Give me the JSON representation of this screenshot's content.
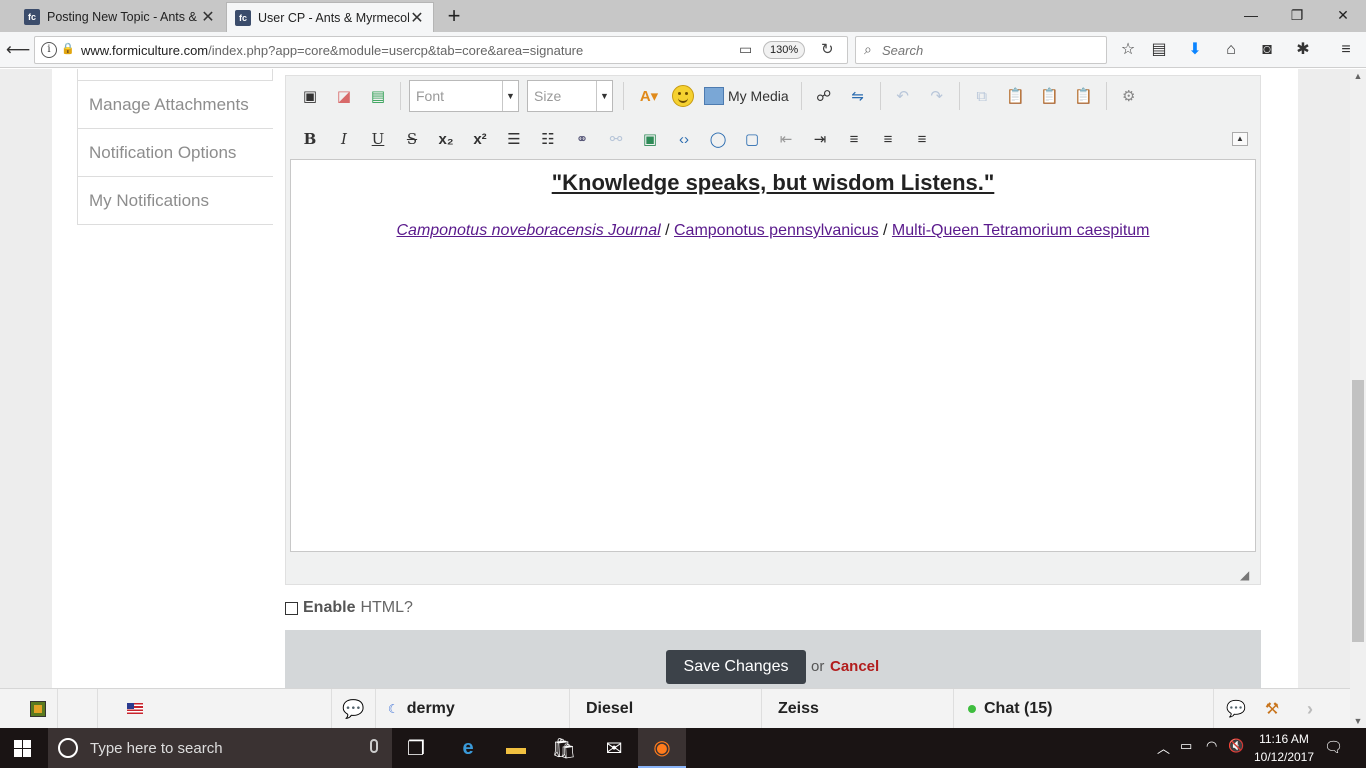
{
  "browser": {
    "tabs": [
      {
        "title": "Posting New Topic - Ants & Myrmecology",
        "favicon": "fc"
      },
      {
        "title": "User CP - Ants & Myrmecology",
        "favicon": "fc"
      }
    ],
    "url_host": "www.formiculture.com",
    "url_path": "/index.php?app=core&module=usercp&tab=core&area=signature",
    "zoom": "130%",
    "search_placeholder": "Search"
  },
  "sidebar": {
    "items": [
      {
        "label": "Manage Attachments"
      },
      {
        "label": "Notification Options"
      },
      {
        "label": "My Notifications"
      }
    ]
  },
  "editor": {
    "font_placeholder": "Font",
    "size_placeholder": "Size",
    "my_media_label": "My Media",
    "bold_glyph": "B",
    "italic_glyph": "I",
    "underline_glyph": "U",
    "strike_glyph": "S",
    "content": {
      "quote": "\"Knowledge speaks, but wisdom Listens.\"",
      "links": [
        {
          "text": "Camponotus noveboracensis Journal"
        },
        {
          "text": "Camponotus pennsylvanicus"
        },
        {
          "text": " Multi-Queen Tetramorium caespitum"
        }
      ],
      "separator": "/"
    }
  },
  "form": {
    "enable_label": "Enable",
    "html_label": "HTML?",
    "save_label": "Save Changes",
    "or_label": "or",
    "cancel_label": "Cancel"
  },
  "chatbar": {
    "users": [
      "dermy",
      "Diesel",
      "Zeiss"
    ],
    "chat_label": "Chat (15)"
  },
  "taskbar": {
    "search_placeholder": "Type here to search",
    "time": "11:16 AM",
    "date": "10/12/2017"
  }
}
